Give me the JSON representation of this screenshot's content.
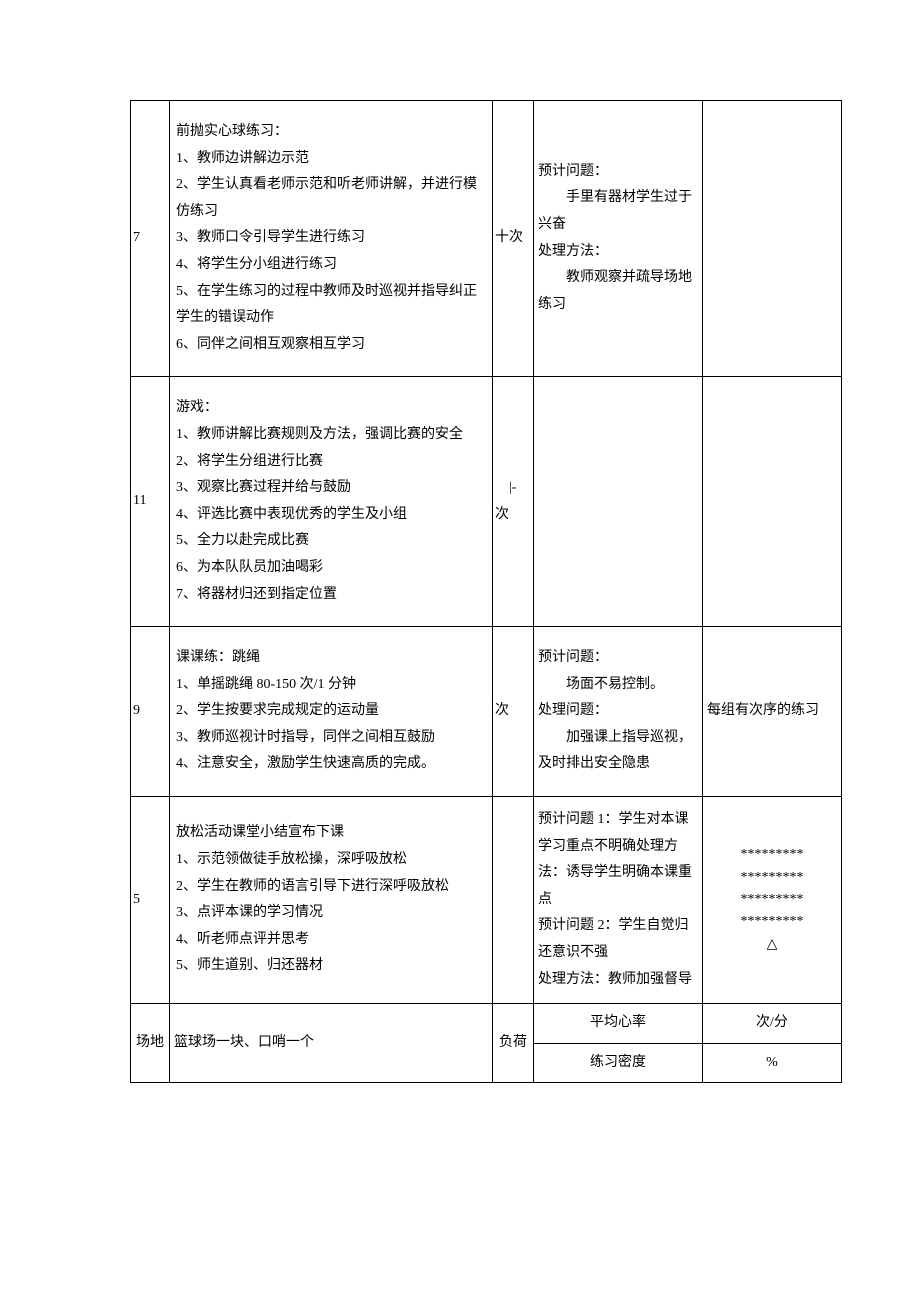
{
  "rows": [
    {
      "time": "7",
      "activity": "前抛实心球练习：\n1、教师边讲解边示范\n2、学生认真看老师示范和听老师讲解，并进行模仿练习\n3、教师口令引导学生进行练习\n4、将学生分小组进行练习\n5、在学生练习的过程中教师及时巡视并指导纠正学生的错误动作\n6、同伴之间相互观察相互学习",
      "count": "十次",
      "issue": "预计问题：\n　　手里有器材学生过于兴奋\n处理方法：\n　　教师观察并疏导场地练习",
      "note": ""
    },
    {
      "time": "11",
      "activity": "游戏：\n1、教师讲解比赛规则及方法，强调比赛的安全\n2、将学生分组进行比赛\n3、观察比赛过程并给与鼓励\n4、评选比赛中表现优秀的学生及小组\n5、全力以赴完成比赛\n6、为本队队员加油喝彩\n7、将器材归还到指定位置",
      "count": "　|-\n次",
      "issue": "",
      "note": ""
    },
    {
      "time": "9",
      "activity": "课课练：跳绳\n1、单摇跳绳 80-150 次/1 分钟\n2、学生按要求完成规定的运动量\n3、教师巡视计时指导，同伴之间相互鼓励\n4、注意安全，激励学生快速高质的完成。",
      "count": "次",
      "issue": "预计问题：\n　　场面不易控制。\n处理问题：\n　　加强课上指导巡视，及时排出安全隐患",
      "note": "每组有次序的练习"
    },
    {
      "time": "5",
      "activity": "放松活动课堂小结宣布下课\n1、示范领做徒手放松操，深呼吸放松\n2、学生在教师的语言引导下进行深呼吸放松\n3、点评本课的学习情况\n4、听老师点评并思考\n5、师生道别、归还器材",
      "count": "",
      "issue": "预计问题 1：学生对本课学习重点不明确处理方法：诱导学生明确本课重点\n预计问题 2：学生自觉归还意识不强\n处理方法：教师加强督导",
      "note_stars": "*********\n*********\n*********\n*********\n△"
    }
  ],
  "footer": {
    "site_label": "场地",
    "site_value": "篮球场一块、口哨一个",
    "load_label": "负荷",
    "metrics": [
      {
        "label": "平均心率",
        "value": "次/分"
      },
      {
        "label": "练习密度",
        "value": "%"
      }
    ]
  }
}
